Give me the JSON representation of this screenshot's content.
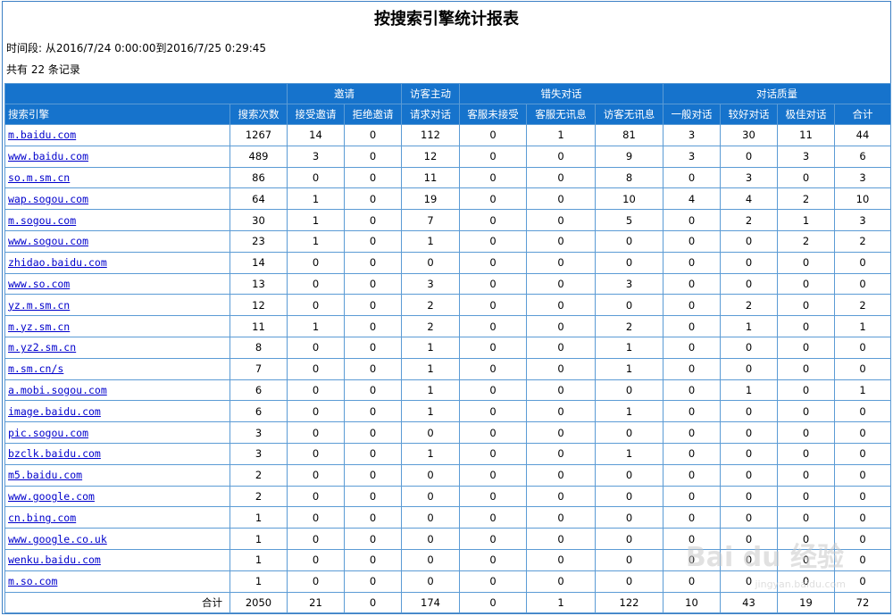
{
  "title": "按搜索引擎统计报表",
  "period": "时间段: 从2016/7/24 0:00:00到2016/7/25 0:29:45",
  "count": "共有 22 条记录",
  "groups": {
    "invite": "邀请",
    "visitor": "访客主动",
    "missed": "错失对话",
    "quality": "对话质量"
  },
  "columns": [
    "搜索引擎",
    "搜索次数",
    "接受邀请",
    "拒绝邀请",
    "请求对话",
    "客服未接受",
    "客服无讯息",
    "访客无讯息",
    "一般对话",
    "较好对话",
    "极佳对话",
    "合计"
  ],
  "rows": [
    [
      "m.baidu.com",
      "1267",
      "14",
      "0",
      "112",
      "0",
      "1",
      "81",
      "3",
      "30",
      "11",
      "44"
    ],
    [
      "www.baidu.com",
      "489",
      "3",
      "0",
      "12",
      "0",
      "0",
      "9",
      "3",
      "0",
      "3",
      "6"
    ],
    [
      "so.m.sm.cn",
      "86",
      "0",
      "0",
      "11",
      "0",
      "0",
      "8",
      "0",
      "3",
      "0",
      "3"
    ],
    [
      "wap.sogou.com",
      "64",
      "1",
      "0",
      "19",
      "0",
      "0",
      "10",
      "4",
      "4",
      "2",
      "10"
    ],
    [
      "m.sogou.com",
      "30",
      "1",
      "0",
      "7",
      "0",
      "0",
      "5",
      "0",
      "2",
      "1",
      "3"
    ],
    [
      "www.sogou.com",
      "23",
      "1",
      "0",
      "1",
      "0",
      "0",
      "0",
      "0",
      "0",
      "2",
      "2"
    ],
    [
      "zhidao.baidu.com",
      "14",
      "0",
      "0",
      "0",
      "0",
      "0",
      "0",
      "0",
      "0",
      "0",
      "0"
    ],
    [
      "www.so.com",
      "13",
      "0",
      "0",
      "3",
      "0",
      "0",
      "3",
      "0",
      "0",
      "0",
      "0"
    ],
    [
      "yz.m.sm.cn",
      "12",
      "0",
      "0",
      "2",
      "0",
      "0",
      "0",
      "0",
      "2",
      "0",
      "2"
    ],
    [
      "m.yz.sm.cn",
      "11",
      "1",
      "0",
      "2",
      "0",
      "0",
      "2",
      "0",
      "1",
      "0",
      "1"
    ],
    [
      "m.yz2.sm.cn",
      "8",
      "0",
      "0",
      "1",
      "0",
      "0",
      "1",
      "0",
      "0",
      "0",
      "0"
    ],
    [
      "m.sm.cn/s",
      "7",
      "0",
      "0",
      "1",
      "0",
      "0",
      "1",
      "0",
      "0",
      "0",
      "0"
    ],
    [
      "a.mobi.sogou.com",
      "6",
      "0",
      "0",
      "1",
      "0",
      "0",
      "0",
      "0",
      "1",
      "0",
      "1"
    ],
    [
      "image.baidu.com",
      "6",
      "0",
      "0",
      "1",
      "0",
      "0",
      "1",
      "0",
      "0",
      "0",
      "0"
    ],
    [
      "pic.sogou.com",
      "3",
      "0",
      "0",
      "0",
      "0",
      "0",
      "0",
      "0",
      "0",
      "0",
      "0"
    ],
    [
      "bzclk.baidu.com",
      "3",
      "0",
      "0",
      "1",
      "0",
      "0",
      "1",
      "0",
      "0",
      "0",
      "0"
    ],
    [
      "m5.baidu.com",
      "2",
      "0",
      "0",
      "0",
      "0",
      "0",
      "0",
      "0",
      "0",
      "0",
      "0"
    ],
    [
      "www.google.com",
      "2",
      "0",
      "0",
      "0",
      "0",
      "0",
      "0",
      "0",
      "0",
      "0",
      "0"
    ],
    [
      "cn.bing.com",
      "1",
      "0",
      "0",
      "0",
      "0",
      "0",
      "0",
      "0",
      "0",
      "0",
      "0"
    ],
    [
      "www.google.co.uk",
      "1",
      "0",
      "0",
      "0",
      "0",
      "0",
      "0",
      "0",
      "0",
      "0",
      "0"
    ],
    [
      "wenku.baidu.com",
      "1",
      "0",
      "0",
      "0",
      "0",
      "0",
      "0",
      "0",
      "0",
      "0",
      "0"
    ],
    [
      "m.so.com",
      "1",
      "0",
      "0",
      "0",
      "0",
      "0",
      "0",
      "0",
      "0",
      "0",
      "0"
    ]
  ],
  "total": [
    "合计",
    "2050",
    "21",
    "0",
    "174",
    "0",
    "1",
    "122",
    "10",
    "43",
    "19",
    "72"
  ],
  "watermark": {
    "logo": "Bai du 经验",
    "url": "jingyan.baidu.com"
  }
}
